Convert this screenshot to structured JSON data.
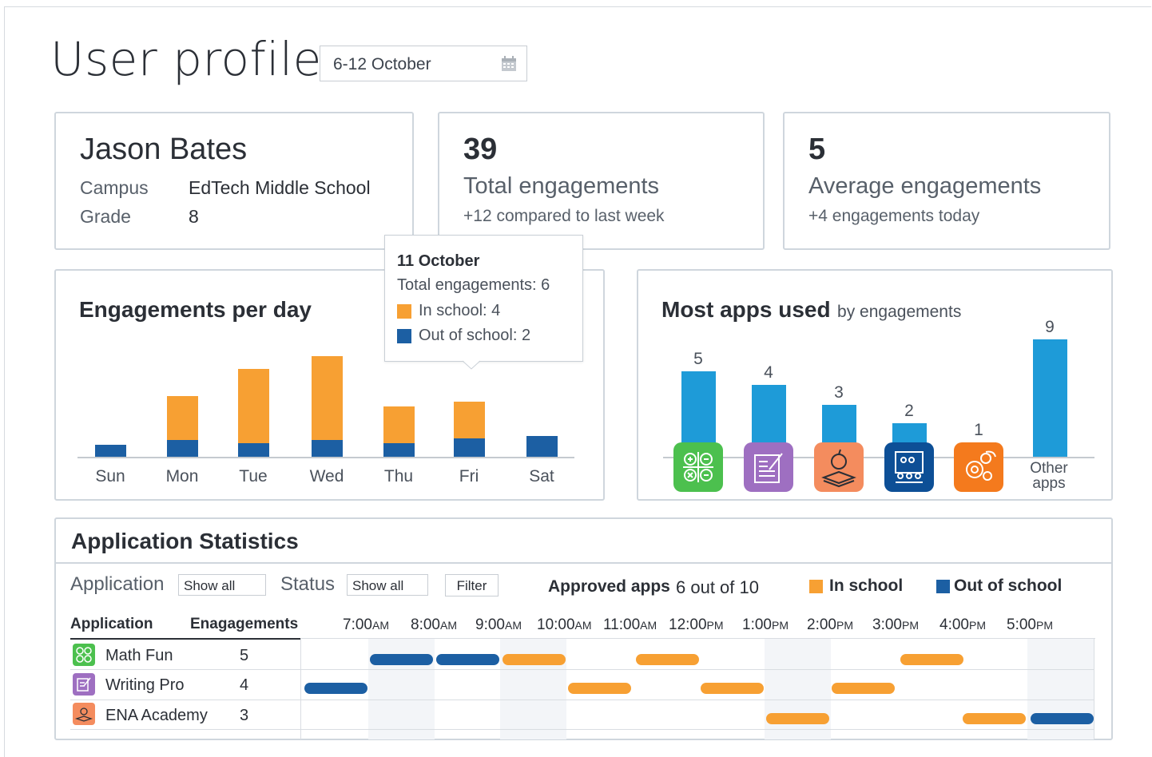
{
  "page": {
    "title": "User profile",
    "date_range": "6-12 October"
  },
  "profile": {
    "name": "Jason Bates",
    "campus_label": "Campus",
    "campus_value": "EdTech Middle School",
    "grade_label": "Grade",
    "grade_value": "8"
  },
  "total": {
    "value": "39",
    "label": "Total engagements",
    "note": "+12 compared to last week"
  },
  "average": {
    "value": "5",
    "label": "Average engagements",
    "note": "+4 engagements today"
  },
  "tooltip": {
    "date": "11 October",
    "total": "Total engagements: 6",
    "in_school": "In school: 4",
    "out_school": "Out of school: 2"
  },
  "engagements_chart": {
    "title": "Engagements per day"
  },
  "apps_chart": {
    "title": "Most apps used",
    "subtitle": "by engagements",
    "other_label_line1": "Other",
    "other_label_line2": "apps"
  },
  "chart_data": [
    {
      "type": "bar",
      "title": "Engagements per day",
      "categories": [
        "Sun",
        "Mon",
        "Tue",
        "Wed",
        "Thu",
        "Fri",
        "Sat"
      ],
      "series": [
        {
          "name": "Out of school",
          "values": [
            1.3,
            1.8,
            1.5,
            1.8,
            1.5,
            2,
            2.3
          ]
        },
        {
          "name": "In school",
          "values": [
            0,
            4.8,
            8.1,
            9.2,
            4,
            4,
            0
          ]
        }
      ],
      "stacked": true,
      "colors": {
        "in_school": "#f7a033",
        "out_school": "#1c5fa3"
      }
    },
    {
      "type": "bar",
      "title": "Most apps used",
      "categories": [
        "Math Fun",
        "Writing Pro",
        "ENA Academy",
        "Classroom",
        "Settings",
        "Other apps"
      ],
      "values": [
        5,
        4,
        3,
        2,
        1,
        9
      ],
      "color": "#1e9bd8"
    }
  ],
  "stats": {
    "title": "Application Statistics",
    "application_label": "Application",
    "application_select": "Show all",
    "status_label": "Status",
    "status_select": "Show all",
    "filter_label": "Filter",
    "approved_label": "Approved apps",
    "approved_value": "6 out of 10",
    "legend_in": "In school",
    "legend_out": "Out of school",
    "col_application": "Application",
    "col_engagements": "Enagagements",
    "times": [
      {
        "t": "7:00",
        "s": "AM"
      },
      {
        "t": "8:00",
        "s": "AM"
      },
      {
        "t": "9:00",
        "s": "AM"
      },
      {
        "t": "10:00",
        "s": "AM"
      },
      {
        "t": "11:00",
        "s": "AM"
      },
      {
        "t": "12:00",
        "s": "PM"
      },
      {
        "t": "1:00",
        "s": "PM"
      },
      {
        "t": "2:00",
        "s": "PM"
      },
      {
        "t": "3:00",
        "s": "PM"
      },
      {
        "t": "4:00",
        "s": "PM"
      },
      {
        "t": "5:00",
        "s": "PM"
      }
    ],
    "rows": [
      {
        "name": "Math Fun",
        "count": "5",
        "icon": "math-icon"
      },
      {
        "name": "Writing Pro",
        "count": "4",
        "icon": "writing-icon"
      },
      {
        "name": "ENA Academy",
        "count": "3",
        "icon": "apple-book-icon"
      }
    ]
  },
  "colors": {
    "orange": "#f7a033",
    "navy": "#1c5fa3",
    "sky": "#1e9bd8",
    "green": "#4cc04e",
    "purple": "#9e6fc1",
    "salmon": "#f48c5e",
    "dark_blue": "#0d4f96",
    "bright_orange": "#f47a1d"
  }
}
